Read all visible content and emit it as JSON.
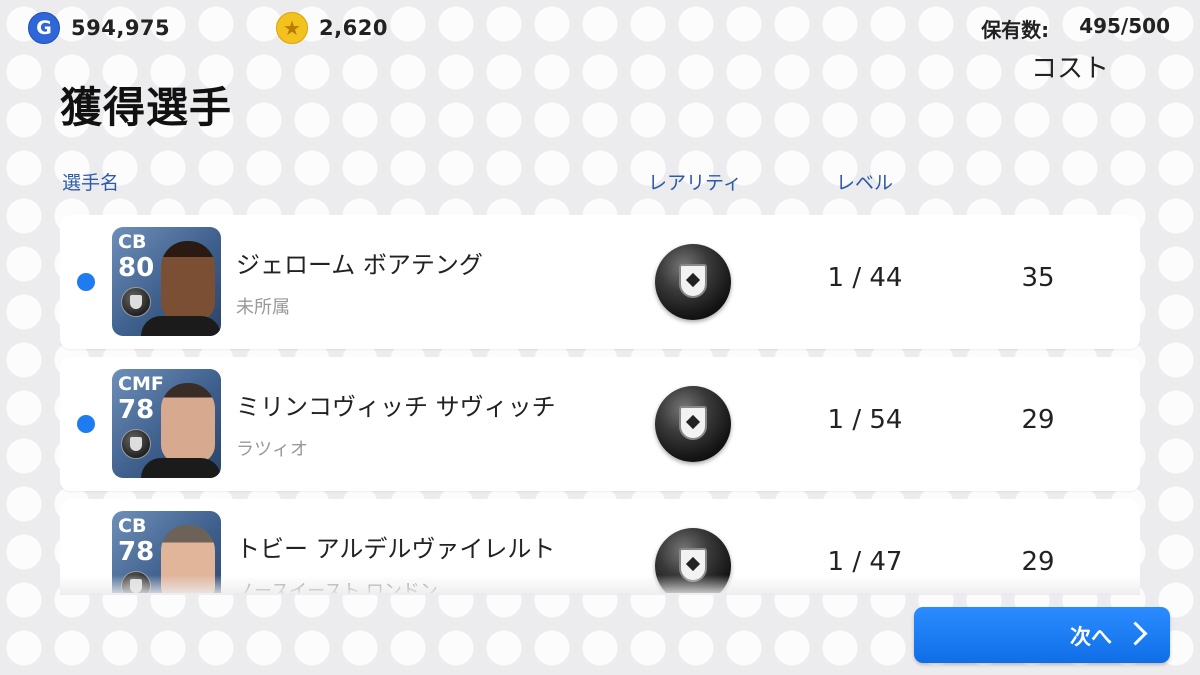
{
  "currency": {
    "gp_icon_letter": "G",
    "gp_value": "594,975",
    "coin_icon": "star-icon",
    "coin_value": "2,620"
  },
  "owned": {
    "label": "保有数:",
    "value": "495/500"
  },
  "page_title": "獲得選手",
  "columns": {
    "name": "選手名",
    "rarity": "レアリティ",
    "level": "レベル",
    "cost": "コスト"
  },
  "players": [
    {
      "position": "CB",
      "rating": "80",
      "name": "ジェローム ボアテング",
      "team": "未所属",
      "level": "1 / 44",
      "cost": "35",
      "is_new": true
    },
    {
      "position": "CMF",
      "rating": "78",
      "name": "ミリンコヴィッチ サヴィッチ",
      "team": "ラツィオ",
      "level": "1 / 54",
      "cost": "29",
      "is_new": true
    },
    {
      "position": "CB",
      "rating": "78",
      "name": "トビー アルデルヴァイレルト",
      "team": "ノースイースト ロンドン",
      "level": "1 / 47",
      "cost": "29",
      "is_new": false
    }
  ],
  "next_button": {
    "label": "次へ"
  },
  "colors": {
    "accent_blue": "#1e7cf0",
    "header_text_blue": "#2d5aa8",
    "gp_blue": "#2f67d8",
    "coin_gold": "#f4c21f"
  }
}
